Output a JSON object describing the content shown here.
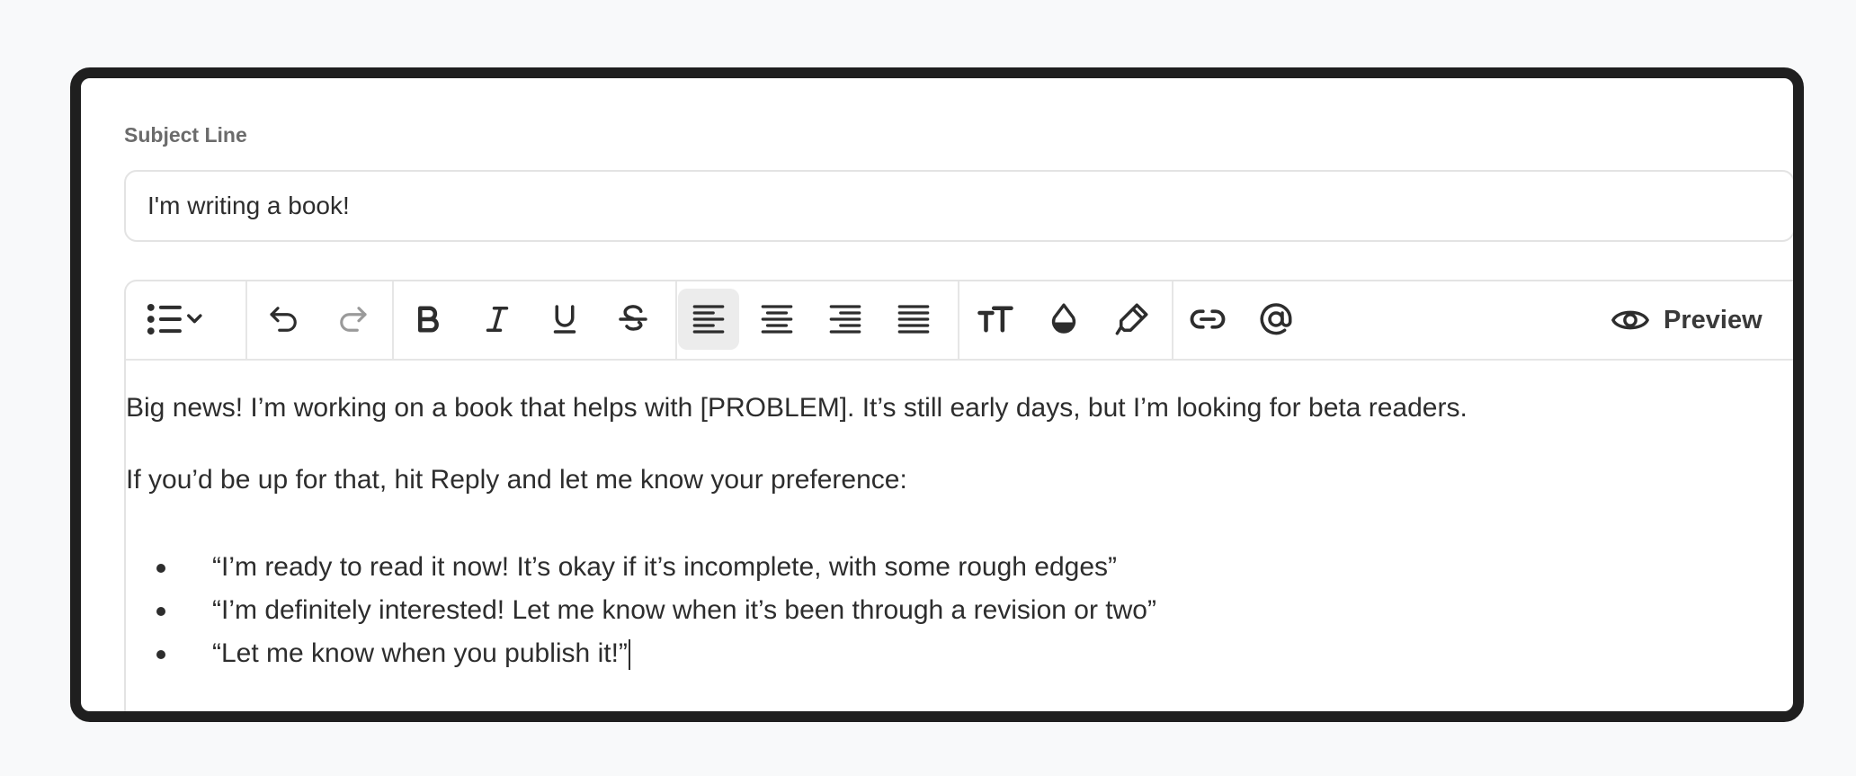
{
  "subject": {
    "label": "Subject Line",
    "value": "I'm writing a book!"
  },
  "toolbar": {
    "buttons": [
      {
        "name": "list-dropdown",
        "icon": "bulleted-list-icon"
      },
      {
        "name": "undo",
        "icon": "undo-icon"
      },
      {
        "name": "redo",
        "icon": "redo-icon"
      },
      {
        "name": "bold",
        "icon": "bold-icon"
      },
      {
        "name": "italic",
        "icon": "italic-icon"
      },
      {
        "name": "underline",
        "icon": "underline-icon"
      },
      {
        "name": "strikethrough",
        "icon": "strikethrough-icon"
      },
      {
        "name": "align-left",
        "icon": "align-left-icon",
        "active": true
      },
      {
        "name": "align-center",
        "icon": "align-center-icon"
      },
      {
        "name": "align-right",
        "icon": "align-right-icon"
      },
      {
        "name": "align-justify",
        "icon": "align-justify-icon"
      },
      {
        "name": "font-size",
        "icon": "text-size-icon"
      },
      {
        "name": "text-color",
        "icon": "color-drop-icon"
      },
      {
        "name": "highlight",
        "icon": "highlighter-icon"
      },
      {
        "name": "link",
        "icon": "link-icon"
      },
      {
        "name": "mention",
        "icon": "at-sign-icon"
      }
    ],
    "preview_label": "Preview"
  },
  "body": {
    "paragraph_1": "Big news! I’m working on a book that helps with [PROBLEM]. It’s still early days, but I’m looking for beta readers.",
    "paragraph_2": "If you’d be up for that, hit Reply and let me know your preference:",
    "bullets": [
      "“I’m ready to read it now! It’s okay if it’s incomplete, with some rough edges”",
      "“I’m definitely interested! Let me know when it’s been through a revision or two”",
      "“Let me know when you publish it!”"
    ]
  },
  "colors": {
    "frame_border": "#1f1f1f",
    "text": "#2d2d2d",
    "label": "#6b6b6b",
    "border": "#e3e3e3",
    "active_button_bg": "#ececec"
  }
}
